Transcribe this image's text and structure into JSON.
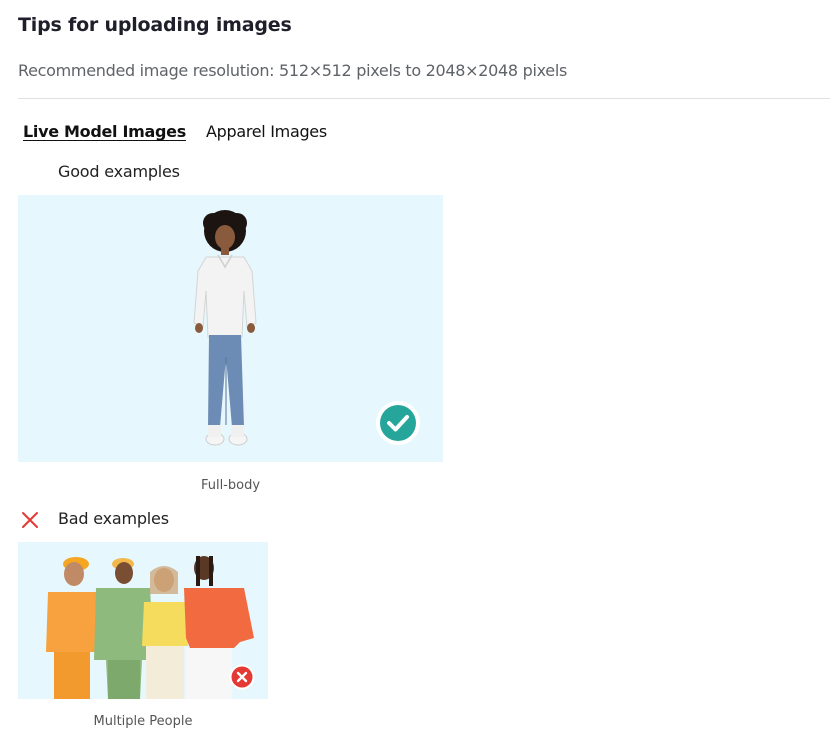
{
  "header": {
    "title": "Tips for uploading images",
    "subtitle": "Recommended image resolution: 512×512 pixels to 2048×2048 pixels"
  },
  "tabs": [
    {
      "label": "Live Model Images",
      "active": true
    },
    {
      "label": "Apparel Images",
      "active": false
    }
  ],
  "good": {
    "label": "Good examples",
    "caption": "Full-body",
    "badge_icon": "check-circle-icon",
    "badge_color": "#26a69a"
  },
  "bad": {
    "label": "Bad examples",
    "caption": "Multiple People",
    "label_icon": "close-icon",
    "badge_icon": "x-circle-icon",
    "badge_color": "#e53935"
  },
  "colors": {
    "image_background": "#e6f8fd",
    "divider": "#e0e0e0"
  }
}
